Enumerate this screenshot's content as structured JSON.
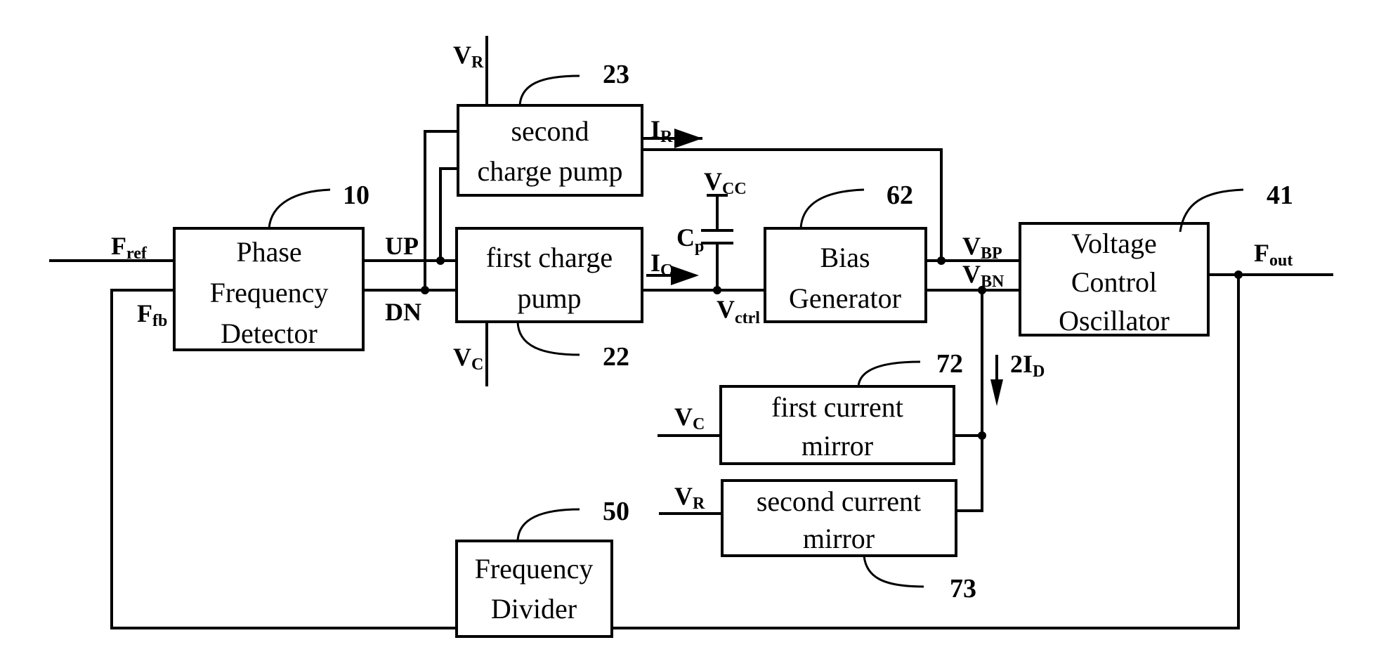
{
  "blocks": {
    "pfd": {
      "ref": "10",
      "lines": [
        "Phase",
        "Frequency",
        "Detector"
      ]
    },
    "cp2": {
      "ref": "23",
      "lines": [
        "second",
        "charge pump"
      ]
    },
    "cp1": {
      "ref": "22",
      "lines": [
        "first charge",
        "pump"
      ]
    },
    "bias": {
      "ref": "62",
      "lines": [
        "Bias",
        "Generator"
      ]
    },
    "vco": {
      "ref": "41",
      "lines": [
        "Voltage",
        "Control",
        "Oscillator"
      ]
    },
    "cm1": {
      "ref": "72",
      "lines": [
        "first current",
        "mirror"
      ]
    },
    "cm2": {
      "ref": "73",
      "lines": [
        "second current",
        "mirror"
      ]
    },
    "div": {
      "ref": "50",
      "lines": [
        "Frequency",
        "Divider"
      ]
    }
  },
  "signals": {
    "fref": {
      "main": "F",
      "sub": "ref"
    },
    "ffb": {
      "main": "F",
      "sub": "fb"
    },
    "up": {
      "main": "UP"
    },
    "dn": {
      "main": "DN"
    },
    "vr_top": {
      "main": "V",
      "sub": "R"
    },
    "vc_bottom": {
      "main": "V",
      "sub": "C"
    },
    "ir": {
      "main": "I",
      "sub": "R"
    },
    "ic": {
      "main": "I",
      "sub": "C"
    },
    "vcc": {
      "main": "V",
      "sub": "CC"
    },
    "cp": {
      "main": "C",
      "sub": "p"
    },
    "vctrl": {
      "main": "V",
      "sub": "ctrl"
    },
    "vbp": {
      "main": "V",
      "sub": "BP"
    },
    "vbn": {
      "main": "V",
      "sub": "BN"
    },
    "fout": {
      "main": "F",
      "sub": "out"
    },
    "id2": {
      "main": "2I",
      "sub": "D"
    },
    "vc_cm": {
      "main": "V",
      "sub": "C"
    },
    "vr_cm": {
      "main": "V",
      "sub": "R"
    }
  }
}
